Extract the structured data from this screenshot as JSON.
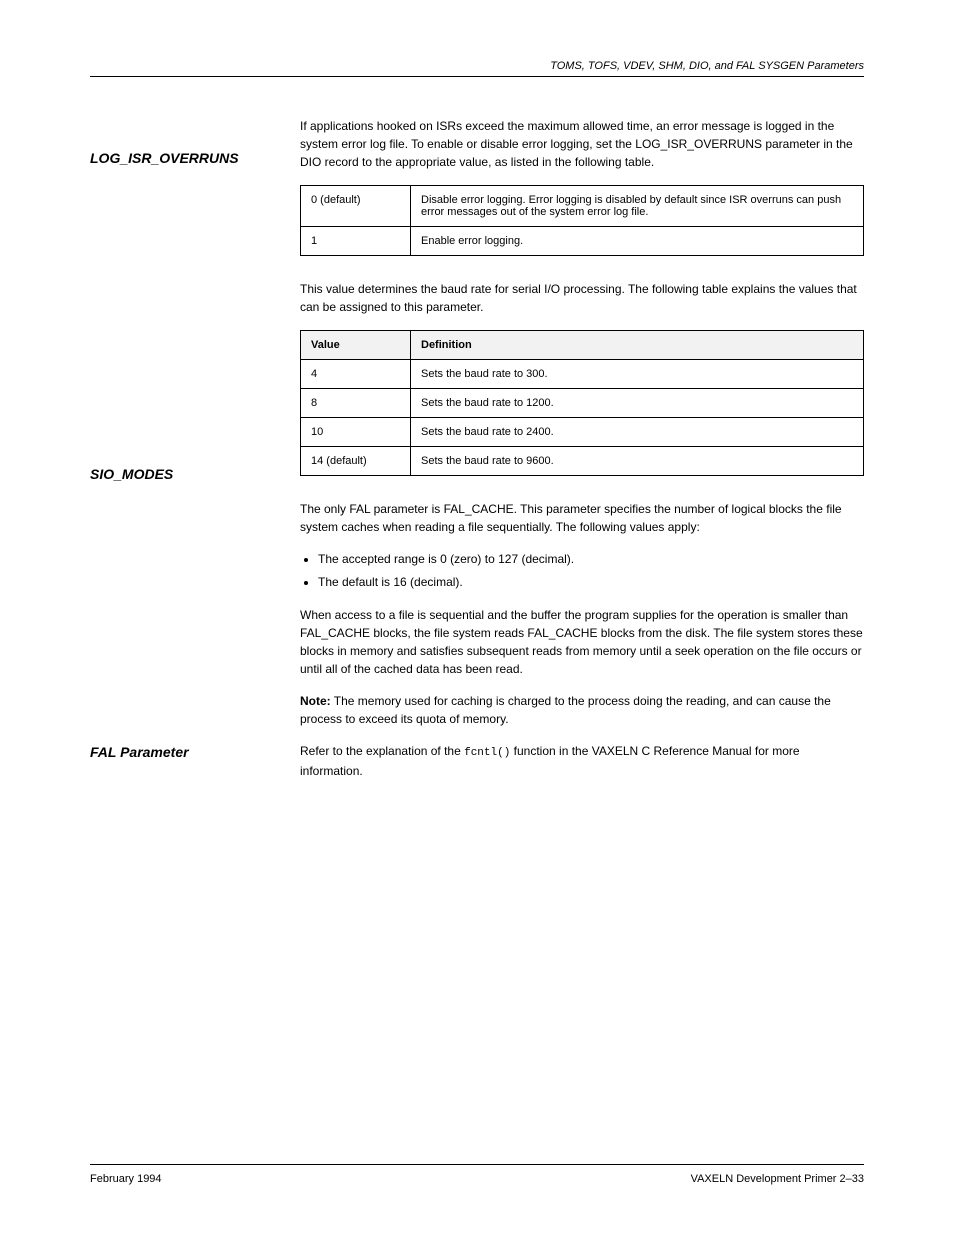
{
  "header": {
    "right": "TOMS, TOFS, VDEV, SHM, DIO, and FAL SYSGEN Parameters"
  },
  "section1": {
    "heading": "LOG_ISR_OVERRUNS",
    "intro": "If applications hooked on ISRs exceed the maximum allowed time, an error message is logged in the system error log file. To enable or disable error logging, set the LOG_ISR_OVERRUNS parameter in the DIO record to the appropriate value, as listed in the following table.",
    "table": {
      "rows": [
        {
          "value": "0 (default)",
          "desc": "Disable error logging. Error logging is disabled by default since ISR overruns can push error messages out of the system error log file."
        },
        {
          "value": "1",
          "desc": "Enable error logging."
        }
      ]
    }
  },
  "section2": {
    "heading": "SIO_MODES",
    "intro": "This value determines the baud rate for serial I/O processing. The following table explains the values that can be assigned to this parameter.",
    "table": {
      "headers": [
        "Value",
        "Definition"
      ],
      "rows": [
        {
          "value": "4",
          "desc": "Sets the baud rate to 300."
        },
        {
          "value": "8",
          "desc": "Sets the baud rate to 1200."
        },
        {
          "value": "10",
          "desc": "Sets the baud rate to 2400."
        },
        {
          "value": "14 (default)",
          "desc": "Sets the baud rate to 9600."
        }
      ]
    }
  },
  "section3": {
    "heading": "FAL Parameter",
    "p1": "The only FAL parameter is FAL_CACHE. This parameter specifies the number of logical blocks the file system caches when reading a file sequentially. The following values apply:",
    "bullets": [
      "The accepted range is 0 (zero) to 127 (decimal).",
      "The default is 16 (decimal)."
    ],
    "p2": "When access to a file is sequential and the buffer the program supplies for the operation is smaller than FAL_CACHE blocks, the file system reads FAL_CACHE blocks from the disk. The file system stores these blocks in memory and satisfies subsequent reads from memory until a seek operation on the file occurs or until all of the cached data has been read.",
    "note_label": "Note:",
    "note_text": "The memory used for caching is charged to the process doing the reading, and can cause the process to exceed its quota of memory.",
    "p3_prefix": "Refer to the explanation of the ",
    "p3_code": "fcntl()",
    "p3_suffix": " function in the VAXELN C Reference Manual for more information."
  },
  "footer": {
    "left": "February 1994",
    "right": "VAXELN Development Primer   2–33"
  }
}
